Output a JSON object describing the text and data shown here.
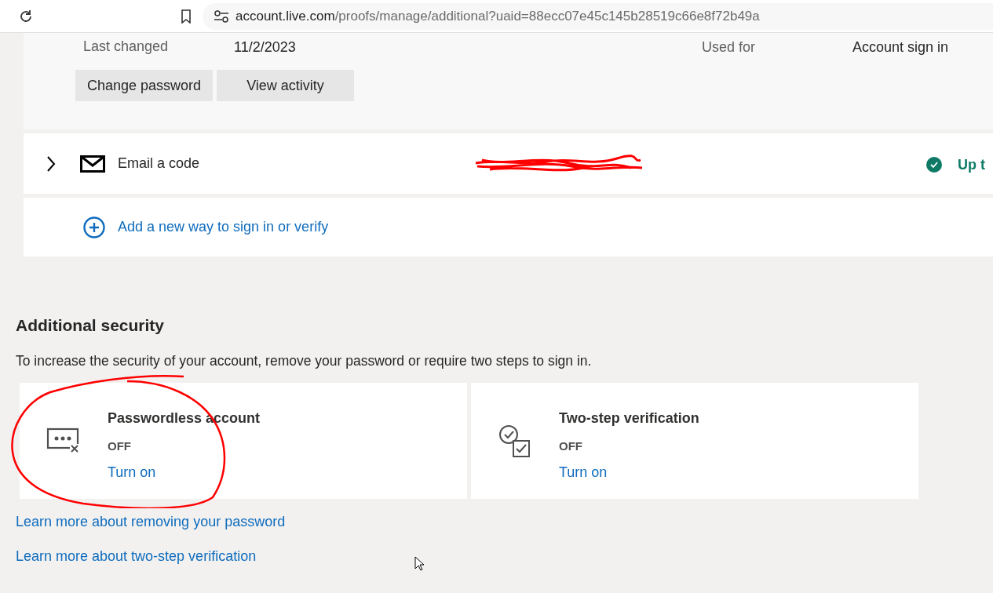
{
  "browser": {
    "url_host": "account.live.com",
    "url_path": "/proofs/manage/additional?uaid=88ecc07e45c145b28519c66e8f72b49a"
  },
  "password_panel": {
    "last_changed_label": "Last changed",
    "last_changed_value": "11/2/2023",
    "used_for_label": "Used for",
    "used_for_value": "Account sign in",
    "buttons": [
      "Change password",
      "View activity"
    ]
  },
  "methods": [
    {
      "kind": "email",
      "label": "Email a code",
      "expanded": false,
      "status": "Up t"
    }
  ],
  "add_method": {
    "label": "Add a new way to sign in or verify"
  },
  "additional_security": {
    "title": "Additional security",
    "description": "To increase the security of your account, remove your password or require two steps to sign in.",
    "cards": [
      {
        "kind": "passwordless",
        "title": "Passwordless account",
        "state": "OFF",
        "action": "Turn on"
      },
      {
        "kind": "two_step",
        "title": "Two-step verification",
        "state": "OFF",
        "action": "Turn on"
      }
    ],
    "links": [
      "Learn more about removing your password",
      "Learn more about two-step verification"
    ]
  }
}
